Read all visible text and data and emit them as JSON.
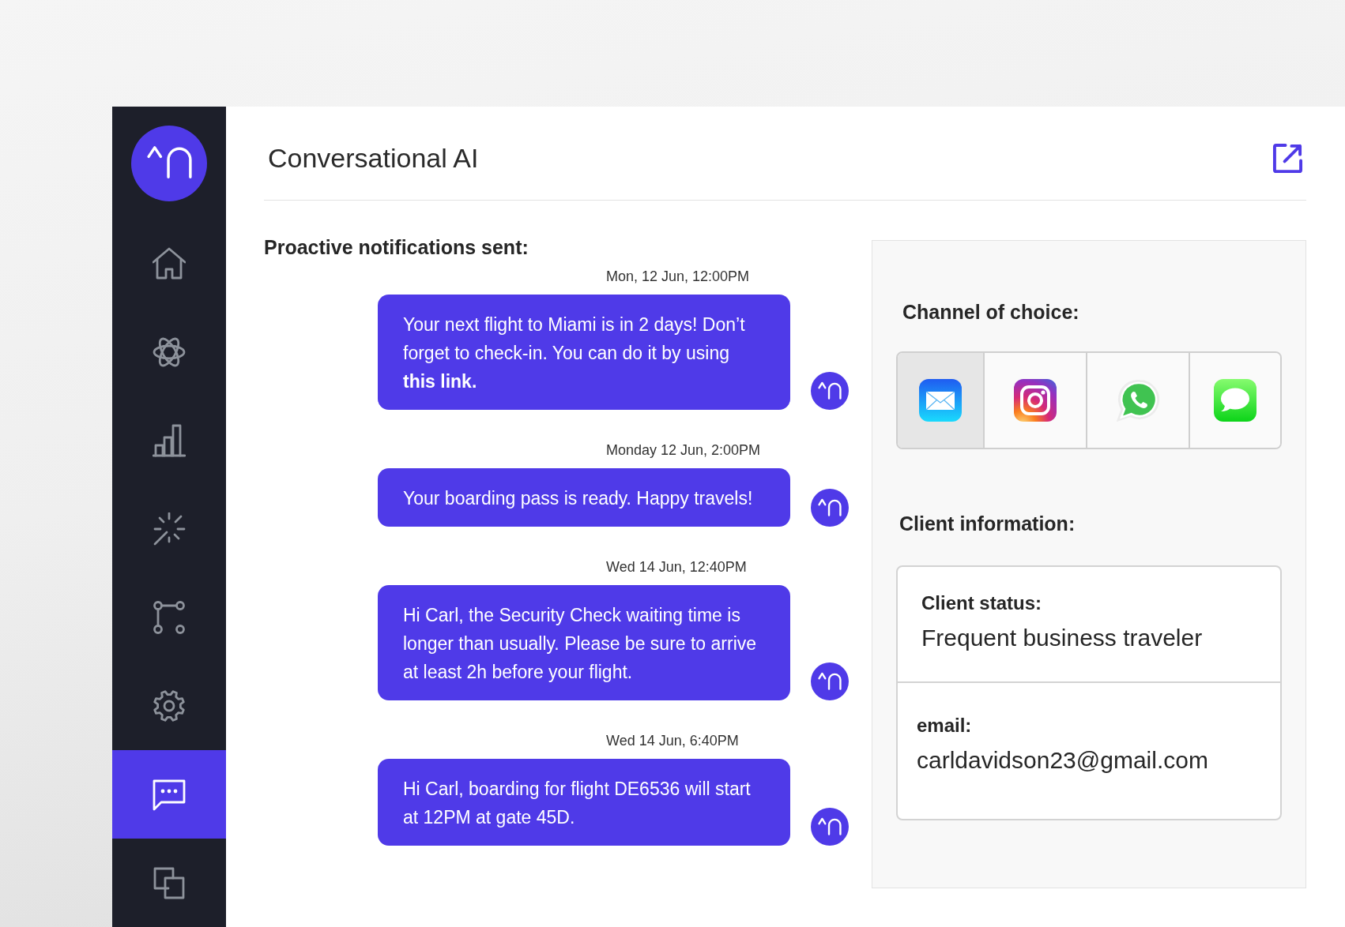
{
  "header": {
    "title": "Conversational AI"
  },
  "sidebar": {
    "items": [
      {
        "selected": false
      },
      {
        "selected": false
      },
      {
        "selected": false
      },
      {
        "selected": false
      },
      {
        "selected": false
      },
      {
        "selected": false
      },
      {
        "selected": true
      },
      {
        "selected": false
      }
    ]
  },
  "notifications": {
    "heading": "Proactive notifications sent:",
    "messages": [
      {
        "time": "Mon, 12 Jun, 12:00PM",
        "text": "Your next flight to Miami is in 2 days! Don’t forget to check-in. You can do it by using **this link.**"
      },
      {
        "time": "Monday 12 Jun, 2:00PM",
        "text": "Your boarding pass is ready. Happy travels!"
      },
      {
        "time": "Wed 14 Jun, 12:40PM",
        "text": "Hi Carl, the Security Check waiting time is longer than usually. Please be sure to arrive at least 2h before your flight."
      },
      {
        "time": "Wed 14 Jun, 6:40PM",
        "text": "Hi Carl, boarding for flight DE6536 will start at 12PM at gate 45D."
      }
    ]
  },
  "channels": {
    "heading": "Channel of choice:",
    "items": [
      {
        "selected": true
      },
      {
        "selected": false
      },
      {
        "selected": false
      },
      {
        "selected": false
      }
    ]
  },
  "client_info": {
    "heading": "Client information:",
    "fields": [
      {
        "label": "Client status:",
        "value": "Frequent business traveler"
      },
      {
        "label": "email:",
        "value": "carldavidson23@gmail.com"
      }
    ]
  }
}
